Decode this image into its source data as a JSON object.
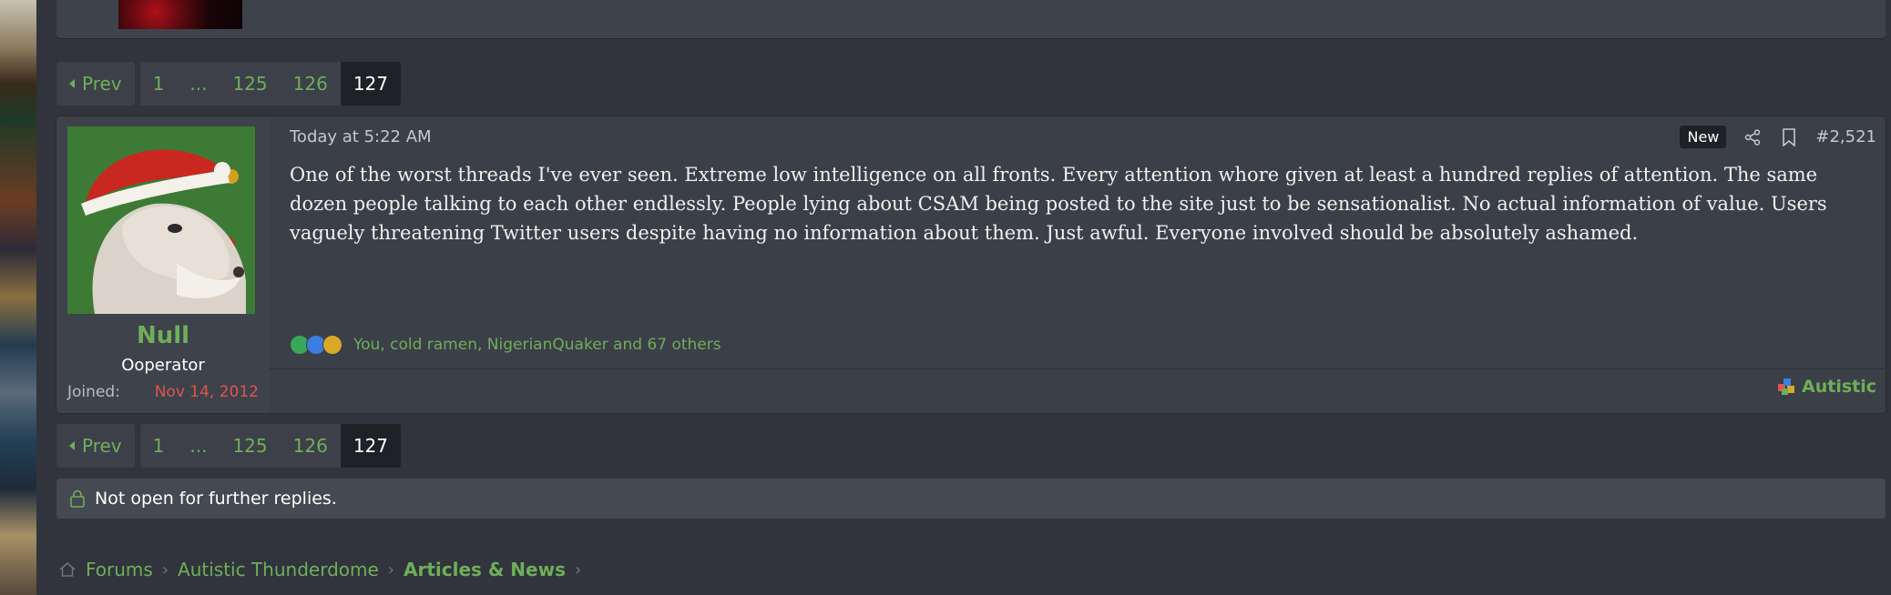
{
  "pagination": {
    "prev_label": "Prev",
    "pages": [
      "1",
      "...",
      "125",
      "126",
      "127"
    ],
    "current": "127"
  },
  "post": {
    "author": {
      "username": "Null",
      "title": "Ooperator",
      "joined_label": "Joined:",
      "joined_date": "Nov 14, 2012"
    },
    "date": "Today at 5:22 AM",
    "badge": "New",
    "number": "#2,521",
    "body": "One of the worst threads I've ever seen. Extreme low intelligence on all fronts. Every attention whore given at least a hundred replies of attention. The same dozen people talking to each other endlessly. People lying about CSAM being posted to the site just to be sensationalist. No actual information of value. Users vaguely threatening Twitter users despite having no information about them. Just awful. Everyone involved should be absolutely ashamed.",
    "reactions_text": "You, cold ramen, NigerianQuaker and 67 others",
    "reaction_icons": [
      "check-icon",
      "thumbs-up-icon",
      "medal-icon"
    ],
    "footer_label": "Autistic"
  },
  "notice": {
    "text": "Not open for further replies."
  },
  "breadcrumb": {
    "items": [
      "Forums",
      "Autistic Thunderdome",
      "Articles & News"
    ]
  },
  "colors": {
    "accent": "#6fae5a",
    "joined_date": "#e0554d",
    "background": "#31343c"
  }
}
